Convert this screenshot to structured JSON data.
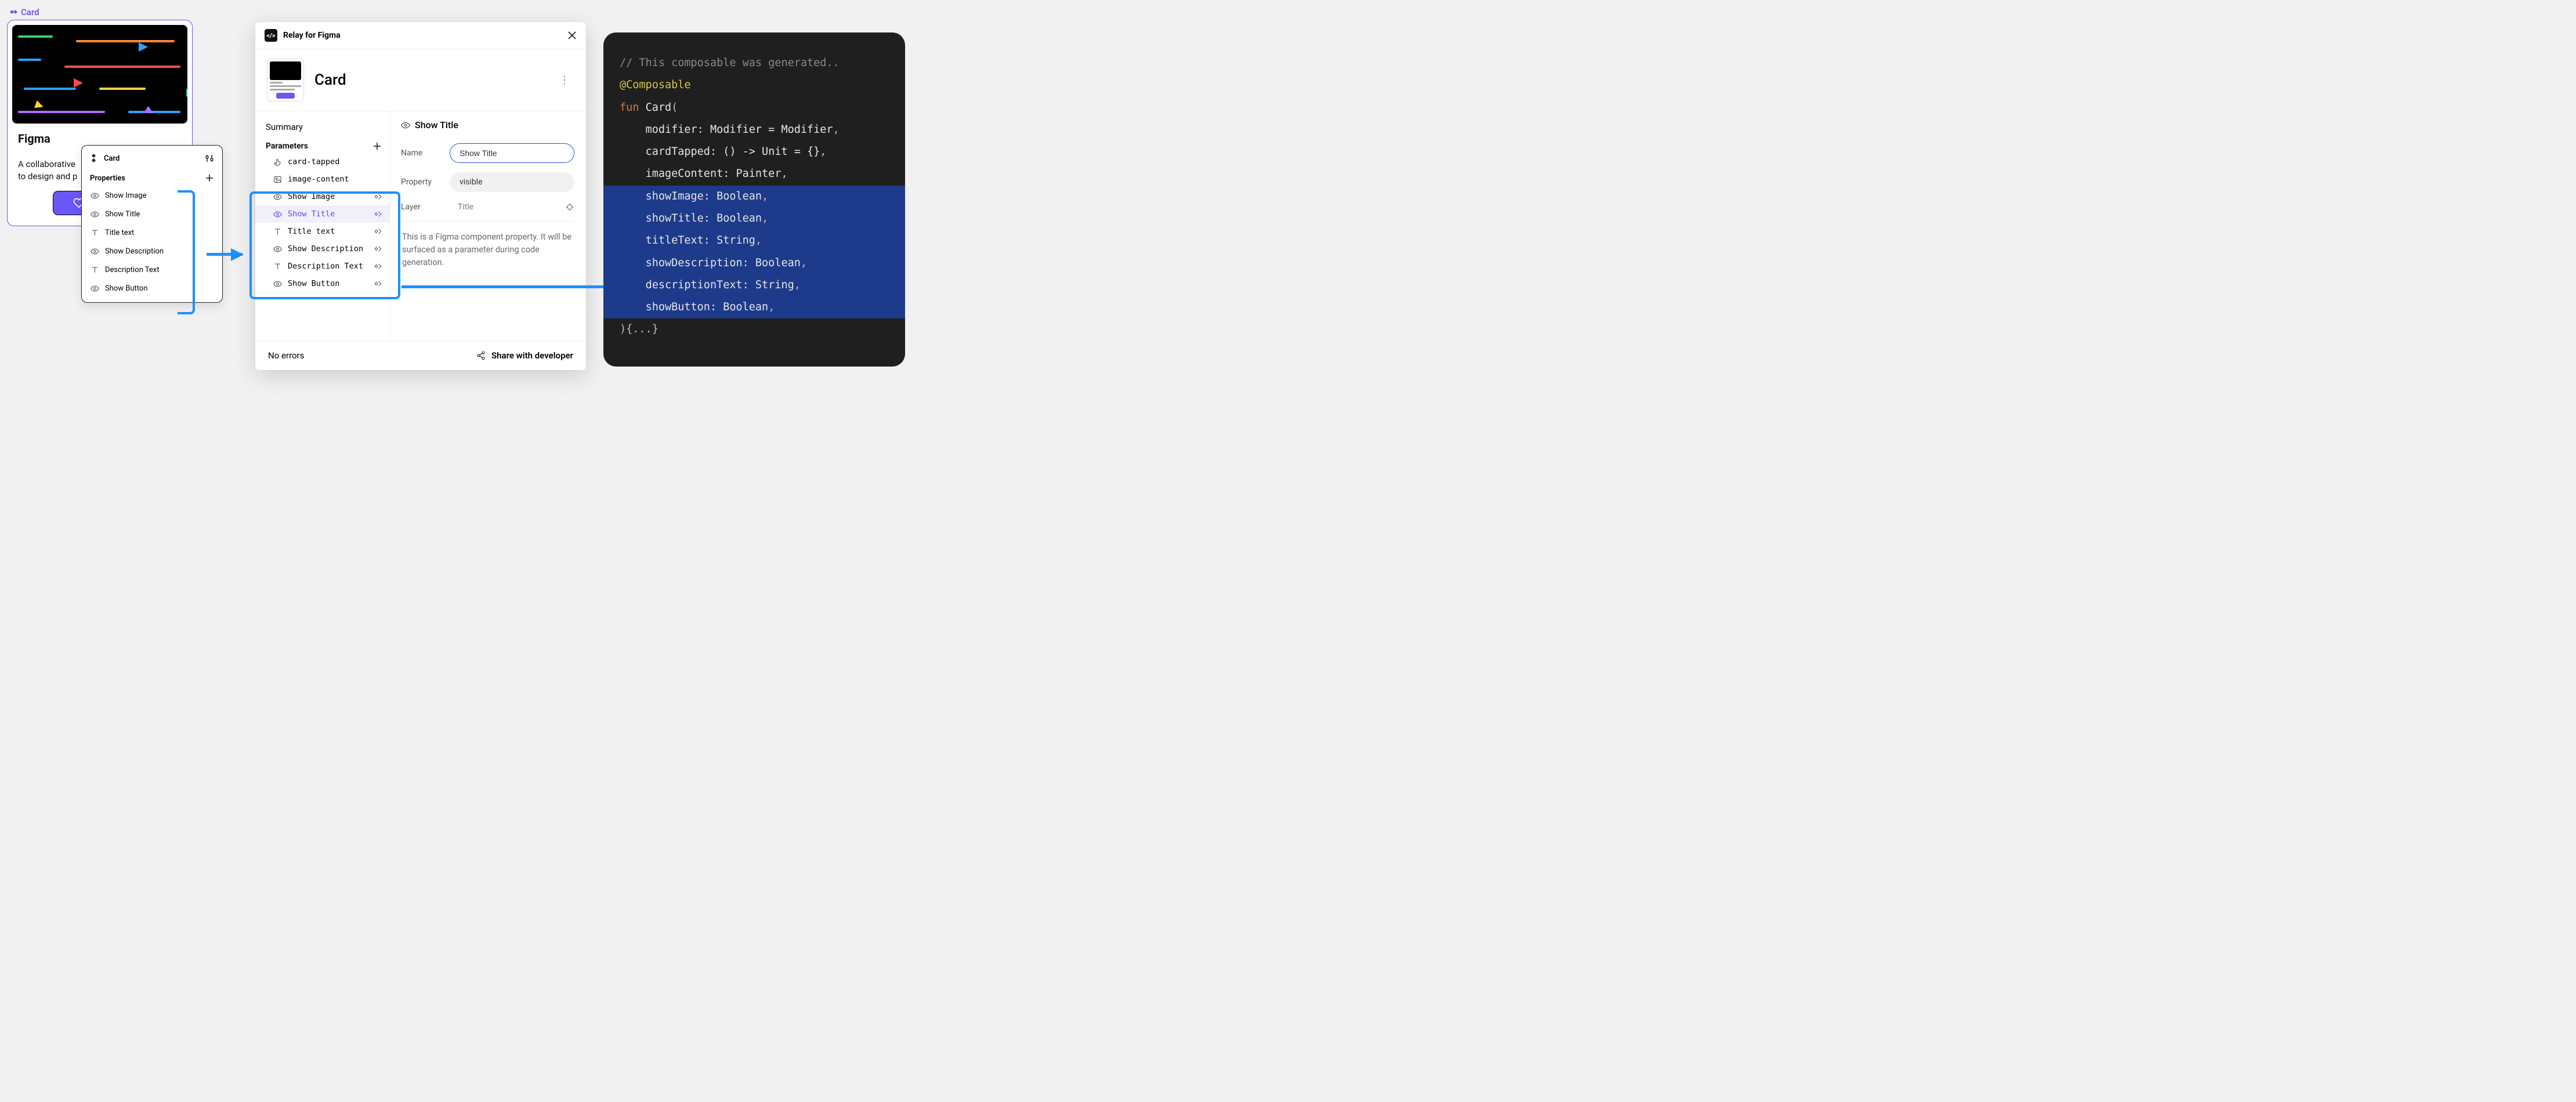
{
  "figma": {
    "component_label": "Card",
    "card": {
      "title": "Figma",
      "description_line1": "A collaborative",
      "description_line2": "to design and p",
      "button_icon": "heart"
    }
  },
  "properties_popover": {
    "title": "Card",
    "section": "Properties",
    "items": [
      {
        "icon": "eye",
        "label": "Show Image"
      },
      {
        "icon": "eye",
        "label": "Show Title"
      },
      {
        "icon": "text",
        "label": "Title text"
      },
      {
        "icon": "eye",
        "label": "Show Description"
      },
      {
        "icon": "text",
        "label": "Description Text"
      },
      {
        "icon": "eye",
        "label": "Show Button"
      }
    ]
  },
  "relay": {
    "app_name": "Relay for Figma",
    "headline": "Card",
    "left": {
      "summary_label": "Summary",
      "parameters_label": "Parameters",
      "params": [
        {
          "icon": "tap",
          "label": "card-tapped",
          "selected": false,
          "tail": false
        },
        {
          "icon": "image",
          "label": "image-content",
          "selected": false,
          "tail": false
        },
        {
          "icon": "eye",
          "label": "Show Image",
          "selected": false,
          "tail": true
        },
        {
          "icon": "eye",
          "label": "Show Title",
          "selected": true,
          "tail": true
        },
        {
          "icon": "text",
          "label": "Title text",
          "selected": false,
          "tail": true
        },
        {
          "icon": "eye",
          "label": "Show Description",
          "selected": false,
          "tail": true
        },
        {
          "icon": "text",
          "label": "Description Text",
          "selected": false,
          "tail": true
        },
        {
          "icon": "eye",
          "label": "Show Button",
          "selected": false,
          "tail": true
        }
      ]
    },
    "right": {
      "head_label": "Show Title",
      "name_label": "Name",
      "name_value": "Show Title",
      "property_label": "Property",
      "property_value": "visible",
      "layer_label": "Layer",
      "layer_value": "Title",
      "helper_text": "This is a Figma component property. It will be surfaced as a parameter during code generation."
    },
    "footer": {
      "status": "No errors",
      "share_label": "Share with developer"
    }
  },
  "code": {
    "comment": "// This composable was generated..",
    "annotation": "@Composable",
    "fun_kw": "fun",
    "fn_name": "Card",
    "params": [
      "modifier: Modifier = Modifier,",
      "cardTapped: () -> Unit = {},",
      "imageContent: Painter,"
    ],
    "highlighted_params": [
      "showImage: Boolean,",
      "showTitle: Boolean,",
      "titleText: String,",
      "showDescription: Boolean,",
      "descriptionText: String,",
      "showButton: Boolean,"
    ],
    "close": "){...}"
  }
}
